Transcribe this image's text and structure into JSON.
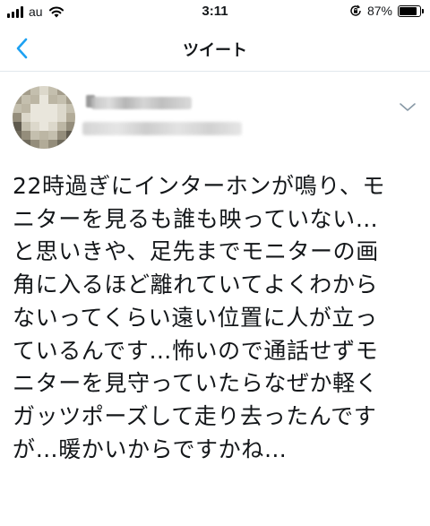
{
  "status_bar": {
    "carrier": "au",
    "time": "3:11",
    "battery_percent_text": "87%",
    "battery_level": 0.87,
    "icons": [
      "signal-icon",
      "wifi-icon",
      "rotation-lock-icon",
      "battery-icon"
    ]
  },
  "nav": {
    "title": "ツイート",
    "back_icon": "chevron-left-icon"
  },
  "tweet": {
    "author_blurred": true,
    "more_icon": "chevron-down-icon",
    "lines": [
      "22時過ぎにインターホンが鳴り、モ",
      "ニターを見るも誰も映っていない…",
      "と思いきや、足先までモニターの画",
      "角に入るほど離れていてよくわから",
      "ないってくらい遠い位置に人が立っ",
      "ているんです…怖いので通話せずモ",
      "ニターを見守っていたらなぜか軽く",
      "ガッツポーズして走り去ったんです",
      "が…暖かいからですかね…"
    ]
  },
  "colors": {
    "accent": "#1da1f2",
    "text": "#14171a",
    "divider": "#e1e8ed"
  }
}
